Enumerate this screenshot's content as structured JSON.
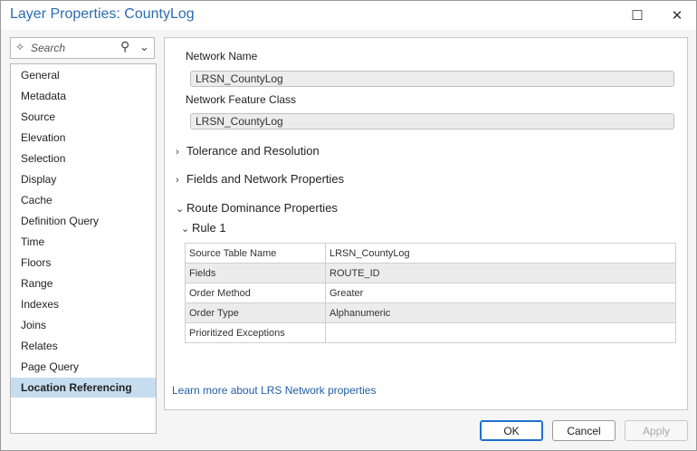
{
  "window": {
    "title": "Layer Properties: CountyLog"
  },
  "titlebar": {
    "maximize_glyph": "☐",
    "close_glyph": "✕"
  },
  "search": {
    "placeholder": "Search"
  },
  "nav": {
    "items": [
      {
        "label": "General"
      },
      {
        "label": "Metadata"
      },
      {
        "label": "Source"
      },
      {
        "label": "Elevation"
      },
      {
        "label": "Selection"
      },
      {
        "label": "Display"
      },
      {
        "label": "Cache"
      },
      {
        "label": "Definition Query"
      },
      {
        "label": "Time"
      },
      {
        "label": "Floors"
      },
      {
        "label": "Range"
      },
      {
        "label": "Indexes"
      },
      {
        "label": "Joins"
      },
      {
        "label": "Relates"
      },
      {
        "label": "Page Query"
      },
      {
        "label": "Location Referencing"
      }
    ],
    "selected": "Location Referencing"
  },
  "main": {
    "network_name_label": "Network Name",
    "network_name_value": "LRSN_CountyLog",
    "network_fc_label": "Network Feature Class",
    "network_fc_value": "LRSN_CountyLog",
    "sections": {
      "tolerance": "Tolerance and Resolution",
      "fields": "Fields and Network Properties",
      "route_dominance": "Route Dominance Properties",
      "rule": "Rule 1"
    },
    "rule_table": [
      {
        "key": "Source Table Name",
        "value": "LRSN_CountyLog"
      },
      {
        "key": "Fields",
        "value": "ROUTE_ID"
      },
      {
        "key": "Order Method",
        "value": "Greater"
      },
      {
        "key": "Order Type",
        "value": "Alphanumeric"
      },
      {
        "key": "Prioritized Exceptions",
        "value": ""
      }
    ],
    "learn_more": "Learn more about LRS Network properties"
  },
  "buttons": {
    "ok": "OK",
    "cancel": "Cancel",
    "apply": "Apply"
  }
}
